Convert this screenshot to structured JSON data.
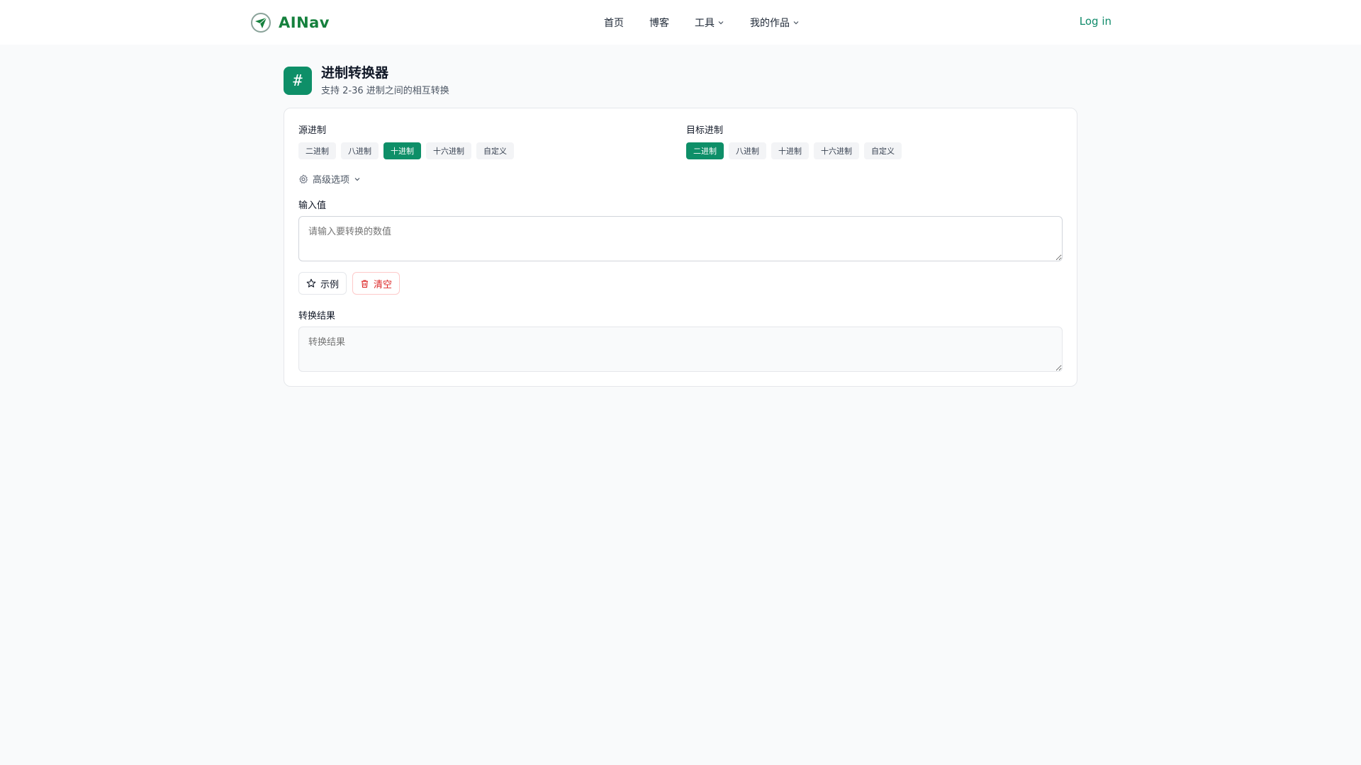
{
  "nav": {
    "brand": "AINav",
    "items": [
      {
        "label": "首页",
        "dropdown": false
      },
      {
        "label": "博客",
        "dropdown": false
      },
      {
        "label": "工具",
        "dropdown": true
      },
      {
        "label": "我的作品",
        "dropdown": true
      }
    ],
    "login": "Log in"
  },
  "header": {
    "icon": "#",
    "title": "进制转换器",
    "subtitle": "支持 2-36 进制之间的相互转换"
  },
  "source": {
    "label": "源进制",
    "options": [
      "二进制",
      "八进制",
      "十进制",
      "十六进制",
      "自定义"
    ],
    "selected": "十进制"
  },
  "target": {
    "label": "目标进制",
    "options": [
      "二进制",
      "八进制",
      "十进制",
      "十六进制",
      "自定义"
    ],
    "selected": "二进制"
  },
  "advanced": {
    "label": "高级选项"
  },
  "input": {
    "label": "输入值",
    "placeholder": "请输入要转换的数值",
    "value": ""
  },
  "buttons": {
    "example": "示例",
    "clear": "清空"
  },
  "result": {
    "label": "转换结果",
    "placeholder": "转换结果",
    "value": ""
  },
  "colors": {
    "accent": "#0e8f68",
    "brand": "#15803d",
    "danger": "#dc2626"
  }
}
